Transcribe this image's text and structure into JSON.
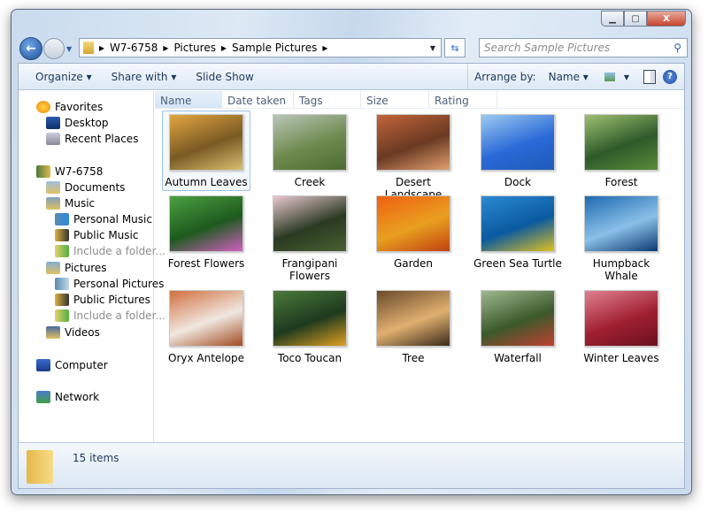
{
  "window": {
    "controls": {
      "minimize": "▁",
      "maximize": "▢",
      "close": "X"
    }
  },
  "address": {
    "crumbs": [
      "W7-6758",
      "Pictures",
      "Sample Pictures"
    ],
    "separator": "▸"
  },
  "search": {
    "placeholder": "Search Sample Pictures"
  },
  "toolbar": {
    "organize": "Organize ▾",
    "share": "Share with ▾",
    "slideshow": "Slide Show",
    "arrange_label": "Arrange by:",
    "arrange_value": "Name ▾",
    "help": "?"
  },
  "nav": {
    "favorites": "Favorites",
    "desktop": "Desktop",
    "recent": "Recent Places",
    "user": "W7-6758",
    "documents": "Documents",
    "music": "Music",
    "personal_music": "Personal Music",
    "public_music": "Public Music",
    "include1": "Include a folder...",
    "pictures": "Pictures",
    "personal_pictures": "Personal Pictures",
    "public_pictures": "Public Pictures",
    "include2": "Include a folder...",
    "videos": "Videos",
    "computer": "Computer",
    "network": "Network"
  },
  "columns": [
    "Name",
    "Date taken",
    "Tags",
    "Size",
    "Rating"
  ],
  "items": [
    {
      "name": "Autumn Leaves",
      "colors": [
        "#7a5a24",
        "#e2a640",
        "#d8c070"
      ]
    },
    {
      "name": "Creek",
      "colors": [
        "#6e8a4e",
        "#b9c6b8",
        "#4d6a33"
      ]
    },
    {
      "name": "Desert Landscape",
      "colors": [
        "#6a3a22",
        "#c2643a",
        "#e0a070"
      ]
    },
    {
      "name": "Dock",
      "colors": [
        "#2a6ad8",
        "#9ccaf0",
        "#1e5ab8"
      ]
    },
    {
      "name": "Forest",
      "colors": [
        "#2e5a2a",
        "#9ec070",
        "#5a8a3a"
      ]
    },
    {
      "name": "Forest Flowers",
      "colors": [
        "#1e5a1e",
        "#4aa040",
        "#d060c0"
      ]
    },
    {
      "name": "Frangipani Flowers",
      "colors": [
        "#2a3a22",
        "#e8c8d0",
        "#4a6030"
      ]
    },
    {
      "name": "Garden",
      "colors": [
        "#e8a020",
        "#f06010",
        "#c04010"
      ]
    },
    {
      "name": "Green Sea Turtle",
      "colors": [
        "#0a5aa0",
        "#2a8ad0",
        "#e0c020"
      ]
    },
    {
      "name": "Humpback Whale",
      "colors": [
        "#8ac0e8",
        "#1e6ab0",
        "#0a3a70"
      ]
    },
    {
      "name": "Oryx Antelope",
      "colors": [
        "#f0e8e0",
        "#d07040",
        "#a04a20"
      ]
    },
    {
      "name": "Toco Toucan",
      "colors": [
        "#1e3a1e",
        "#4a7a3a",
        "#e0a020"
      ]
    },
    {
      "name": "Tree",
      "colors": [
        "#e0b070",
        "#6a4a2a",
        "#3a2a1a"
      ]
    },
    {
      "name": "Waterfall",
      "colors": [
        "#3a5a2a",
        "#a0b890",
        "#c04030"
      ]
    },
    {
      "name": "Winter Leaves",
      "colors": [
        "#a02030",
        "#e08090",
        "#6a1020"
      ]
    }
  ],
  "status": {
    "count": "15 items"
  }
}
